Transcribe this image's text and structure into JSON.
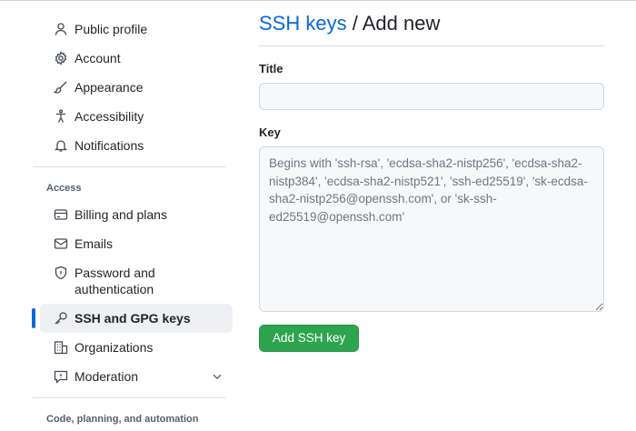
{
  "sidebar": {
    "items": [
      {
        "label": "Public profile",
        "icon": "person-icon"
      },
      {
        "label": "Account",
        "icon": "gear-icon"
      },
      {
        "label": "Appearance",
        "icon": "paintbrush-icon"
      },
      {
        "label": "Accessibility",
        "icon": "accessibility-icon"
      },
      {
        "label": "Notifications",
        "icon": "bell-icon"
      }
    ],
    "access_heading": "Access",
    "access_items": [
      {
        "label": "Billing and plans",
        "icon": "credit-card-icon"
      },
      {
        "label": "Emails",
        "icon": "mail-icon"
      },
      {
        "label": "Password and authentication",
        "icon": "shield-lock-icon"
      },
      {
        "label": "SSH and GPG keys",
        "icon": "key-icon",
        "active": true
      },
      {
        "label": "Organizations",
        "icon": "organization-icon"
      },
      {
        "label": "Moderation",
        "icon": "report-icon"
      }
    ],
    "code_heading": "Code, planning, and automation"
  },
  "main": {
    "breadcrumb_link": "SSH keys",
    "breadcrumb_sep": " / ",
    "breadcrumb_current": "Add new",
    "title_label": "Title",
    "title_value": "",
    "key_label": "Key",
    "key_placeholder": "Begins with 'ssh-rsa', 'ecdsa-sha2-nistp256', 'ecdsa-sha2-nistp384', 'ecdsa-sha2-nistp521', 'ssh-ed25519', 'sk-ecdsa-sha2-nistp256@openssh.com', or 'sk-ssh-ed25519@openssh.com'",
    "submit_label": "Add SSH key"
  },
  "colors": {
    "link": "#0969da",
    "primary_button": "#2da44e",
    "active_indicator": "#0969da"
  }
}
